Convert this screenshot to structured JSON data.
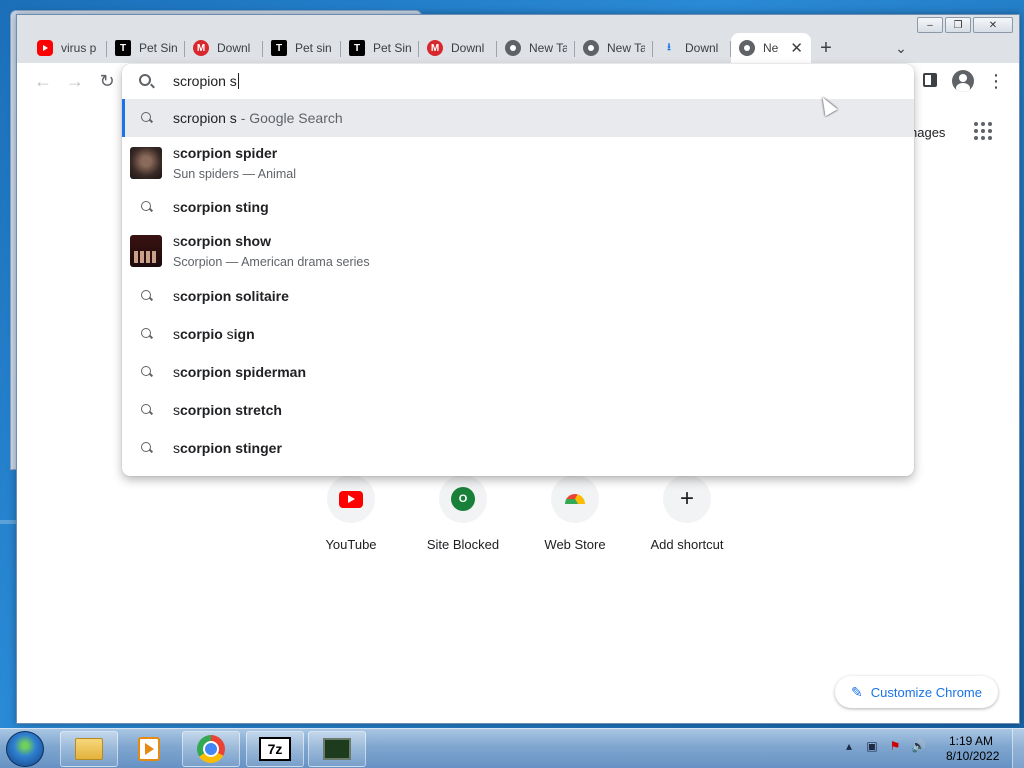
{
  "window": {
    "controls": [
      "minimize",
      "restore",
      "close"
    ]
  },
  "tabs": [
    {
      "favicon": "youtube-icon",
      "title": "virus p"
    },
    {
      "favicon": "t-icon",
      "title": "Pet Sin"
    },
    {
      "favicon": "mega-icon",
      "title": "Downl"
    },
    {
      "favicon": "t-icon",
      "title": "Pet sin"
    },
    {
      "favicon": "t-icon",
      "title": "Pet Sin"
    },
    {
      "favicon": "mega-icon",
      "title": "Downl"
    },
    {
      "favicon": "chrome-icon",
      "title": "New Ta"
    },
    {
      "favicon": "chrome-icon",
      "title": "New Ta"
    },
    {
      "favicon": "download-icon",
      "title": "Downl"
    },
    {
      "favicon": "chrome-icon",
      "title": "Ne",
      "active": true
    }
  ],
  "omnibox": {
    "input_value": "scropion s",
    "suggestions": [
      {
        "type": "search",
        "prefix": "scropion s",
        "suffix": " - Google Search",
        "selected": true
      },
      {
        "type": "entity",
        "lead": "s",
        "bold": "corpion spider",
        "subtitle": "Sun spiders — Animal",
        "thumb": "spider"
      },
      {
        "type": "search",
        "lead": "s",
        "bold": "corpion sting"
      },
      {
        "type": "entity",
        "lead": "s",
        "bold": "corpion show",
        "subtitle": "Scorpion — American drama series",
        "thumb": "show"
      },
      {
        "type": "search",
        "lead": "s",
        "bold": "corpion solitaire"
      },
      {
        "type": "search",
        "lead": "s",
        "bold_parts": [
          "corpio",
          " ",
          "s",
          "ign"
        ]
      },
      {
        "type": "search",
        "lead": "s",
        "bold": "corpion spiderman"
      },
      {
        "type": "search",
        "lead": "s",
        "bold": "corpion stretch"
      },
      {
        "type": "search",
        "lead": "s",
        "bold": "corpion stinger"
      }
    ]
  },
  "ntp": {
    "images_link": "nages",
    "shortcuts": [
      {
        "label": "YouTube",
        "icon": "youtube-icon"
      },
      {
        "label": "Site Blocked",
        "icon": "o-letter-icon"
      },
      {
        "label": "Web Store",
        "icon": "webstore-icon"
      },
      {
        "label": "Add shortcut",
        "icon": "plus-icon"
      }
    ],
    "customize_label": "Customize Chrome"
  },
  "taskbar": {
    "clock_time": "1:19 AM",
    "clock_date": "8/10/2022",
    "apps": [
      "explorer-icon",
      "media-player-icon",
      "chrome-icon",
      "7zip-icon",
      "task-manager-icon"
    ]
  },
  "colors": {
    "accent": "#1a73e8",
    "tab_strip": "#dee1e6",
    "selected_row": "#e8eaed"
  }
}
